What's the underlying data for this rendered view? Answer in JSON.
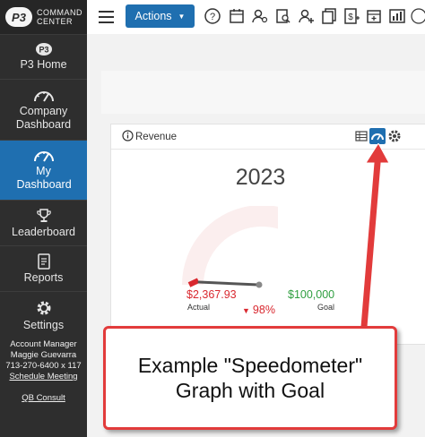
{
  "logo": {
    "badge": "P3",
    "line1": "COMMAND",
    "line2": "CENTER"
  },
  "sidebar": {
    "items": [
      {
        "label": "P3 Home"
      },
      {
        "label": "Company Dashboard"
      },
      {
        "label": "My Dashboard",
        "active": true
      },
      {
        "label": "Leaderboard"
      },
      {
        "label": "Reports"
      },
      {
        "label": "Settings"
      }
    ],
    "contact": {
      "role": "Account Manager",
      "name": "Maggie Guevarra",
      "phone": "713-270-6400 x 117",
      "schedule": "Schedule Meeting",
      "qb": "QB Consult"
    }
  },
  "topbar": {
    "actions_label": "Actions"
  },
  "card": {
    "title": "Revenue",
    "year": "2023"
  },
  "gauge": {
    "actual_value": "$2,367.93",
    "actual_label": "Actual",
    "goal_value": "$100,000",
    "goal_label": "Goal",
    "percent_text": "98%",
    "fill_fraction": 0.02
  },
  "callout": {
    "line1": "Example \"Speedometer\"",
    "line2": "Graph with Goal"
  },
  "colors": {
    "accent": "#1f6fb0",
    "sidebar": "#2e2e2e",
    "actual": "#d9282f",
    "goal": "#2e9e3f",
    "callout_border": "#e23b3b"
  }
}
